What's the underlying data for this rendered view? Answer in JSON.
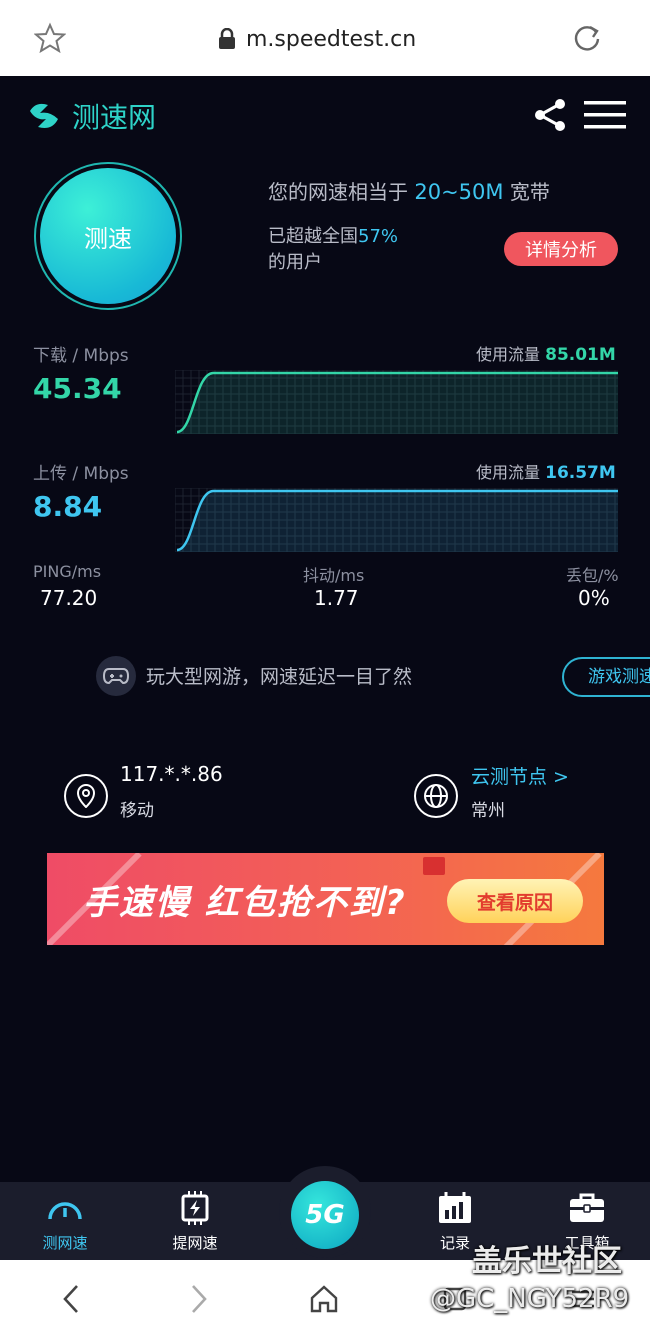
{
  "browser": {
    "url": "m.speedtest.cn"
  },
  "header": {
    "logo_text": "测速网"
  },
  "start_button": {
    "label": "测速"
  },
  "summary": {
    "line1_prefix": "您的网速相当于",
    "bandwidth": "20~50M",
    "line1_suffix": "宽带",
    "beat_prefix": "已超越全国",
    "beat_percent": "57%",
    "beat_suffix": "的用户",
    "detail_button": "详情分析"
  },
  "download": {
    "label": "下载 / Mbps",
    "value": "45.34",
    "usage_label": "使用流量",
    "usage_value": "85.01M",
    "color": "#33d6a8"
  },
  "upload": {
    "label": "上传 / Mbps",
    "value": "8.84",
    "usage_label": "使用流量",
    "usage_value": "16.57M",
    "color": "#3fc6f0"
  },
  "stats": {
    "ping_label": "PING/ms",
    "ping_value": "77.20",
    "jitter_label": "抖动/ms",
    "jitter_value": "1.77",
    "loss_label": "丢包/%",
    "loss_value": "0%"
  },
  "game": {
    "text": "玩大型网游，网速延迟一目了然",
    "button": "游戏测速"
  },
  "connection": {
    "ip": "117.*.*.86",
    "isp": "移动",
    "node_link": "云测节点 >",
    "city": "常州"
  },
  "banner": {
    "title": "手速慢 红包抢不到?",
    "button": "查看原因"
  },
  "bottom_nav": {
    "items": [
      {
        "label": "测网速"
      },
      {
        "label": "提网速"
      },
      {
        "label": "5G"
      },
      {
        "label": "记录"
      },
      {
        "label": "工具箱"
      }
    ]
  },
  "watermark": {
    "line1": "盖乐世社区",
    "line2": "@GC_NGY52R9"
  }
}
